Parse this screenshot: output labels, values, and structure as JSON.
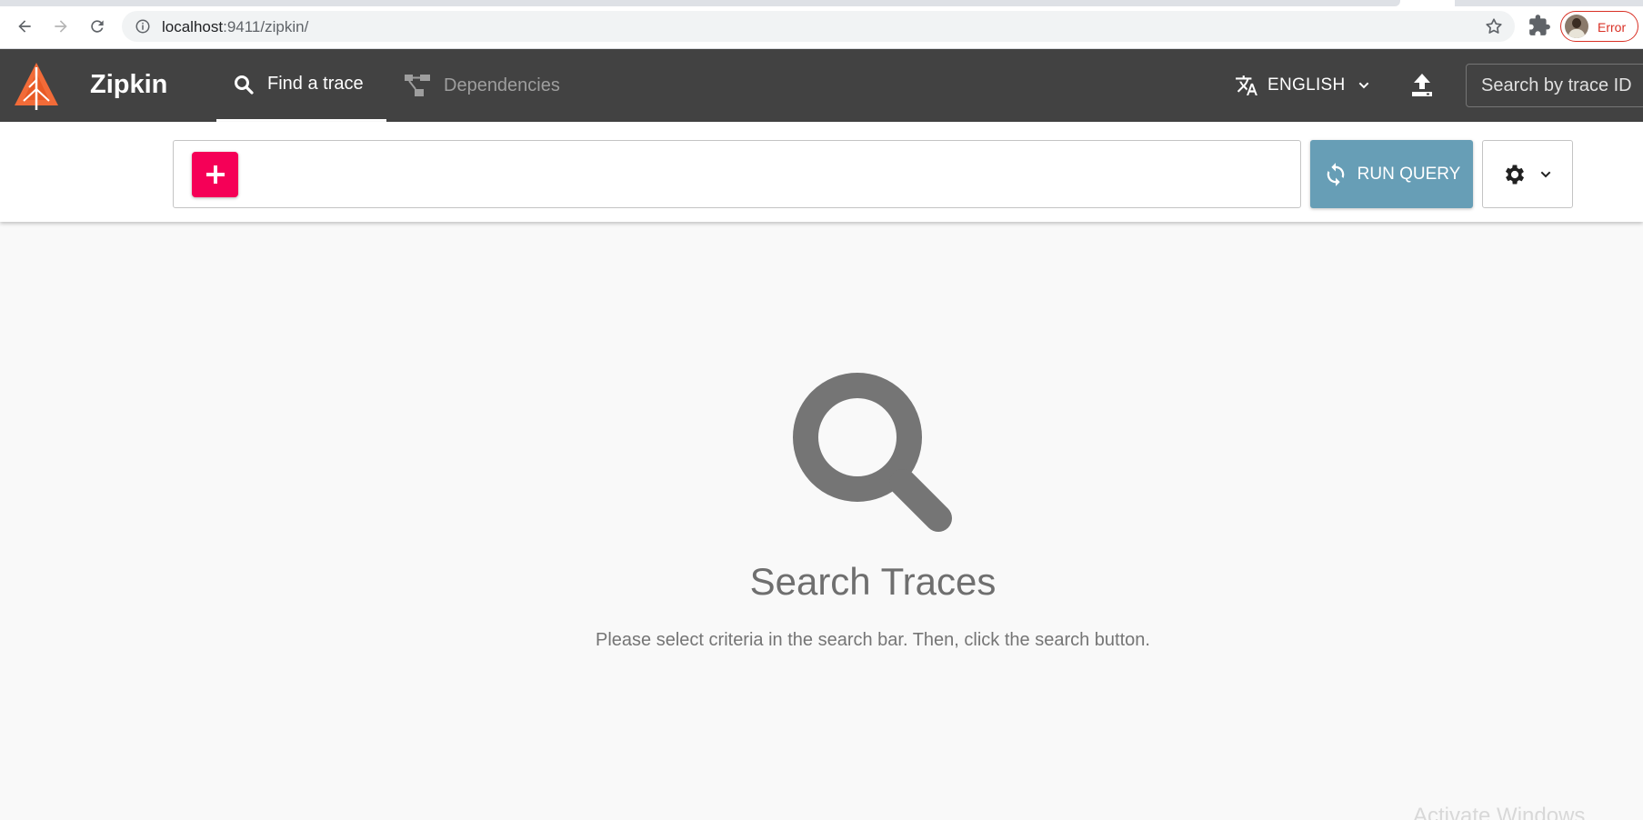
{
  "browser": {
    "url_host": "localhost",
    "url_path": ":9411/zipkin/",
    "profile_status": "Error"
  },
  "header": {
    "brand": "Zipkin",
    "tabs": [
      {
        "label": "Find a trace",
        "icon": "search-icon",
        "active": true
      },
      {
        "label": "Dependencies",
        "icon": "dependencies-icon",
        "active": false
      }
    ],
    "language_label": "ENGLISH",
    "trace_search_placeholder": "Search by trace ID"
  },
  "query_bar": {
    "run_label": "RUN QUERY"
  },
  "empty_state": {
    "title": "Search Traces",
    "description": "Please select criteria in the search bar. Then, click the search button."
  },
  "os_watermark": "Activate Windows",
  "colors": {
    "header_bg": "#424242",
    "add_button": "#f50057",
    "run_button": "#679eb6",
    "logo": "#f26b38"
  }
}
